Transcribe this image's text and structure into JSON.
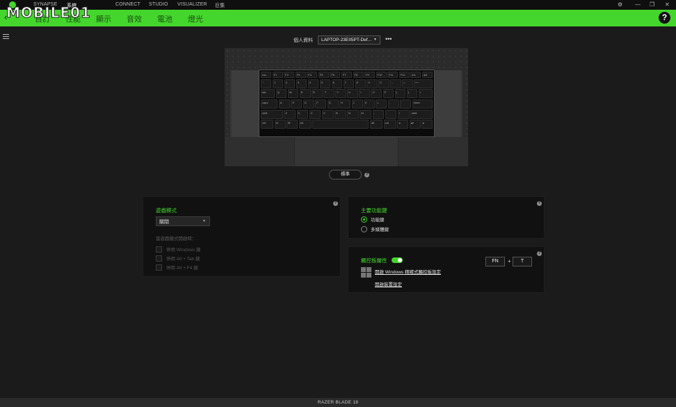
{
  "topnav": {
    "items": [
      "SYNAPSE",
      "系統",
      "CONNECT",
      "STUDIO",
      "VISUALIZER",
      "巨集"
    ],
    "active_index": 1,
    "window_controls": [
      "⚙",
      "—",
      "❐",
      "✕"
    ]
  },
  "watermark": "MOBILE01",
  "tabs": {
    "back": "‹",
    "items": [
      "自訂",
      "性能",
      "顯示",
      "音效",
      "電池",
      "燈光"
    ]
  },
  "help_label": "?",
  "profile": {
    "label": "個人資料",
    "value": "LAPTOP-23EII5PT-Def...",
    "more": "•••"
  },
  "keyboard": {
    "rows": [
      [
        "esc",
        "F1",
        "F2",
        "F3",
        "F4",
        "F5",
        "F6",
        "F7",
        "F8",
        "F9",
        "F10",
        "F11",
        "F12",
        "ins",
        "del"
      ],
      [
        "~",
        "1",
        "2",
        "3",
        "4",
        "5",
        "6",
        "7",
        "8",
        "9",
        "0",
        "-",
        "=",
        "⟵"
      ],
      [
        "tab",
        "Q",
        "W",
        "E",
        "R",
        "T",
        "Y",
        "U",
        "I",
        "O",
        "P",
        "[",
        "]",
        "\\"
      ],
      [
        "caps",
        "A",
        "S",
        "D",
        "F",
        "G",
        "H",
        "J",
        "K",
        "L",
        ";",
        "'",
        "enter"
      ],
      [
        "shift",
        "Z",
        "X",
        "C",
        "V",
        "B",
        "N",
        "M",
        ",",
        ".",
        "/",
        "shift"
      ],
      [
        "ctrl",
        "fn",
        "⊞",
        "alt",
        "",
        "alt",
        "ctrl",
        "◂",
        "▴▾",
        "▸"
      ]
    ]
  },
  "standard_button": "標準",
  "gaming_mode": {
    "title": "遊戲模式",
    "value": "關閉",
    "hint": "當遊戲模式開啟時：",
    "options": [
      "停用 Windows 鍵",
      "停用 Alt + Tab 鍵",
      "停用 Alt + F4 鍵"
    ]
  },
  "primary_key": {
    "title": "主要功能鍵",
    "options": [
      "功能鍵",
      "多媒體鍵"
    ],
    "selected_index": 0
  },
  "touchpad": {
    "title": "觸控板屬性",
    "enabled": true,
    "link1": "開啟 Windows 精確式觸控板設定",
    "link2": "開啟裝置設定",
    "shortcut": [
      "FN",
      "+",
      "T"
    ]
  },
  "footer": "RAZER BLADE 18",
  "colors": {
    "accent": "#44d62c",
    "panel": "#111111",
    "background": "#1b1b1b"
  }
}
